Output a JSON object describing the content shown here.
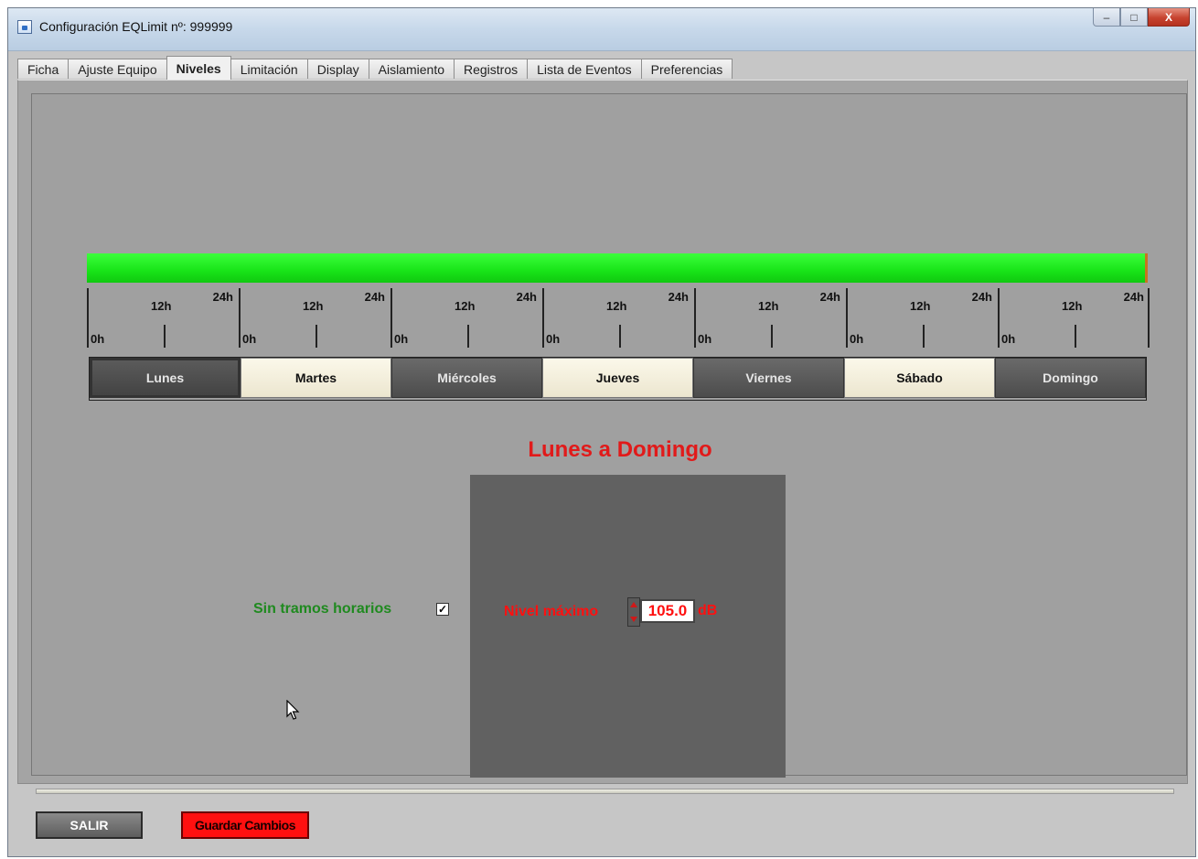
{
  "window": {
    "title": "Configuración EQLimit nº: 999999",
    "controls": {
      "minimize": "‒",
      "maximize": "□",
      "close": "X"
    }
  },
  "tabs": [
    {
      "label": "Ficha",
      "active": false
    },
    {
      "label": "Ajuste Equipo",
      "active": false
    },
    {
      "label": "Niveles",
      "active": true
    },
    {
      "label": "Limitación",
      "active": false
    },
    {
      "label": "Display",
      "active": false
    },
    {
      "label": "Aislamiento",
      "active": false
    },
    {
      "label": "Registros",
      "active": false
    },
    {
      "label": "Lista de Eventos",
      "active": false
    },
    {
      "label": "Preferencias",
      "active": false
    }
  ],
  "timeline": {
    "labels": {
      "start": "0h",
      "mid": "12h",
      "end": "24h"
    },
    "bar_color": "#22ee22"
  },
  "days": [
    {
      "label": "Lunes",
      "style": "selected"
    },
    {
      "label": "Martes",
      "style": "light"
    },
    {
      "label": "Miércoles",
      "style": "dark"
    },
    {
      "label": "Jueves",
      "style": "light"
    },
    {
      "label": "Viernes",
      "style": "dark"
    },
    {
      "label": "Sábado",
      "style": "light"
    },
    {
      "label": "Domingo",
      "style": "dark"
    }
  ],
  "range_title": "Lunes a Domingo",
  "sin_tramos": {
    "label": "Sin tramos horarios",
    "checked": true,
    "mark": "✓"
  },
  "nivel": {
    "label": "Nivel máximo",
    "value": "105.0",
    "unit": "dB"
  },
  "buttons": {
    "salir": "SALIR",
    "guardar": "Guardar Cambios"
  },
  "colors": {
    "accent_red": "#ff1010",
    "green_label": "#1f8a1f",
    "panel": "#a0a0a0"
  },
  "icons": {
    "cursor": "mouse-pointer-icon"
  }
}
